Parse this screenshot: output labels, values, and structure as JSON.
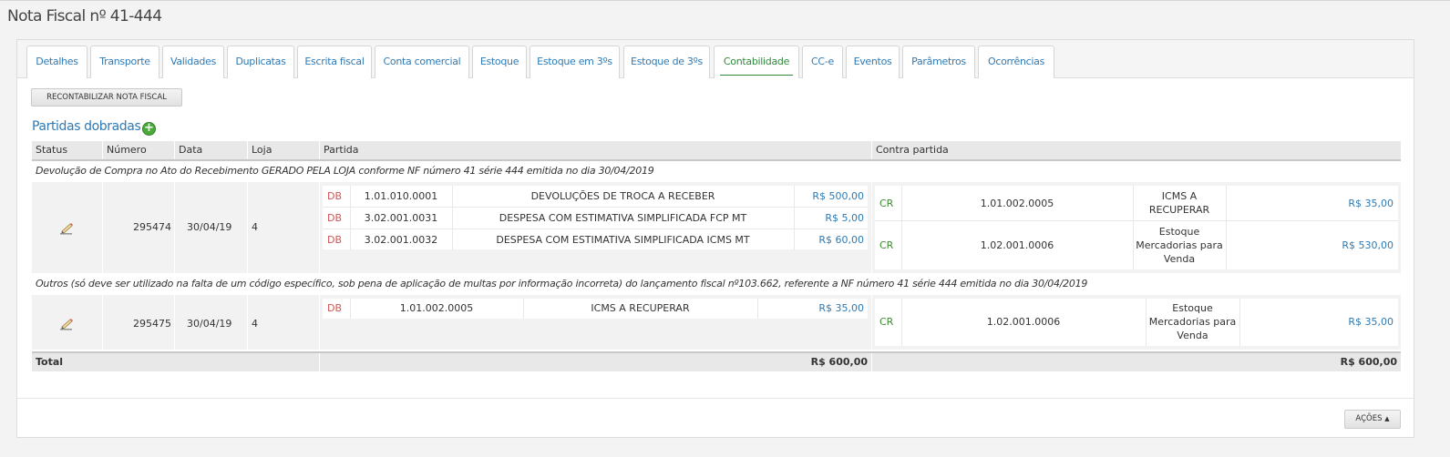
{
  "page": {
    "title": "Nota Fiscal nº 41-444"
  },
  "tabs": [
    {
      "label": "Detalhes"
    },
    {
      "label": "Transporte"
    },
    {
      "label": "Validades"
    },
    {
      "label": "Duplicatas"
    },
    {
      "label": "Escrita fiscal"
    },
    {
      "label": "Conta comercial"
    },
    {
      "label": "Estoque"
    },
    {
      "label": "Estoque em 3ºs"
    },
    {
      "label": "Estoque de 3ºs"
    },
    {
      "label": "Contabilidade",
      "active": true
    },
    {
      "label": "CC-e"
    },
    {
      "label": "Eventos"
    },
    {
      "label": "Parâmetros"
    },
    {
      "label": "Ocorrências"
    }
  ],
  "actions": {
    "recontabilizar": "RECONTABILIZAR NOTA FISCAL",
    "acoes": "AÇÕES"
  },
  "section": {
    "title": "Partidas dobradas"
  },
  "table": {
    "headers": [
      "Status",
      "Número",
      "Data",
      "Loja",
      "Partida",
      "Contra partida"
    ],
    "groups": [
      {
        "note": "Devolução de Compra no Ato do Recebimento GERADO PELA LOJA conforme NF número 41 série 444 emitida no dia 30/04/2019",
        "numero": "295474",
        "data": "30/04/19",
        "loja": "4",
        "partidas": [
          {
            "tipo": "DB",
            "conta": "1.01.010.0001",
            "descricao": "DEVOLUÇÕES DE TROCA A RECEBER",
            "valor": "R$ 500,00"
          },
          {
            "tipo": "DB",
            "conta": "3.02.001.0031",
            "descricao": "DESPESA COM ESTIMATIVA SIMPLIFICADA FCP MT",
            "valor": "R$ 5,00"
          },
          {
            "tipo": "DB",
            "conta": "3.02.001.0032",
            "descricao": "DESPESA COM ESTIMATIVA SIMPLIFICADA ICMS MT",
            "valor": "R$ 60,00"
          }
        ],
        "contrapartidas": [
          {
            "tipo": "CR",
            "conta": "1.01.002.0005",
            "descricao_l1": "ICMS A",
            "descricao_l2": "RECUPERAR",
            "valor": "R$ 35,00"
          },
          {
            "tipo": "CR",
            "conta": "1.02.001.0006",
            "descricao_l1": "Estoque",
            "descricao_l2": "Mercadorias para",
            "descricao_l3": "Venda",
            "valor": "R$ 530,00"
          }
        ]
      },
      {
        "note": "Outros (só deve ser utilizado na falta de um código específico, sob pena de aplicação de multas por informação incorreta) do lançamento fiscal nº103.662, referente a NF número 41 série 444 emitida no dia 30/04/2019",
        "numero": "295475",
        "data": "30/04/19",
        "loja": "4",
        "partidas": [
          {
            "tipo": "DB",
            "conta": "1.01.002.0005",
            "descricao": "ICMS A RECUPERAR",
            "valor": "R$ 35,00"
          }
        ],
        "contrapartidas": [
          {
            "tipo": "CR",
            "conta": "1.02.001.0006",
            "descricao_l1": "Estoque",
            "descricao_l2": "Mercadorias para",
            "descricao_l3": "Venda",
            "valor": "R$ 35,00"
          }
        ]
      }
    ],
    "total": {
      "label": "Total",
      "partida": "R$ 600,00",
      "contra": "R$ 600,00"
    }
  },
  "icons": {
    "status": "edit-pencil-icon",
    "add": "plus-circle-icon"
  },
  "colors": {
    "link": "#2f7ab4",
    "active_tab": "#2e8a3a",
    "debit": "#d9534f",
    "credit": "#3c8a2e",
    "add_button": "#4caa3c"
  }
}
